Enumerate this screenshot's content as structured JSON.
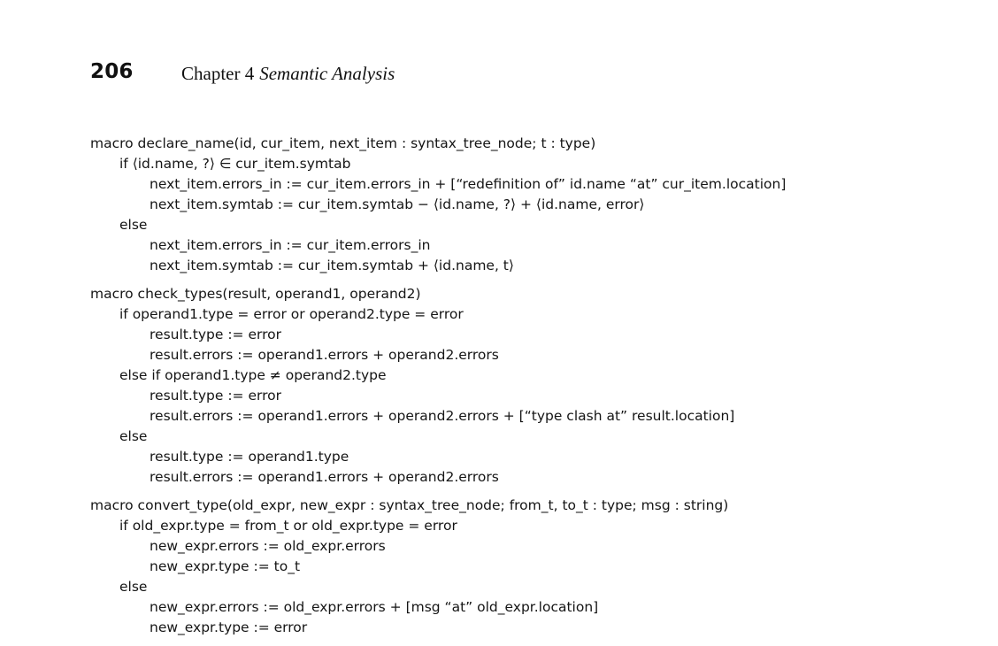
{
  "header": {
    "page_number": "206",
    "chapter_label": "Chapter 4",
    "chapter_title": "Semantic Analysis"
  },
  "code_blocks": [
    {
      "lines": [
        {
          "indent": 0,
          "text": "macro declare_name(id, cur_item, next_item : syntax_tree_node; t : type)"
        },
        {
          "indent": 1,
          "text": "if ⟨id.name, ?⟩ ∈ cur_item.symtab"
        },
        {
          "indent": 2,
          "text": "next_item.errors_in := cur_item.errors_in + [“redefinition of” id.name “at” cur_item.location]"
        },
        {
          "indent": 2,
          "text": "next_item.symtab := cur_item.symtab − ⟨id.name, ?⟩ + ⟨id.name, error⟩"
        },
        {
          "indent": 1,
          "text": "else"
        },
        {
          "indent": 2,
          "text": "next_item.errors_in := cur_item.errors_in"
        },
        {
          "indent": 2,
          "text": "next_item.symtab := cur_item.symtab + ⟨id.name, t⟩"
        }
      ]
    },
    {
      "lines": [
        {
          "indent": 0,
          "text": "macro check_types(result, operand1, operand2)"
        },
        {
          "indent": 1,
          "text": "if operand1.type = error or operand2.type = error"
        },
        {
          "indent": 2,
          "text": "result.type := error"
        },
        {
          "indent": 2,
          "text": "result.errors := operand1.errors + operand2.errors"
        },
        {
          "indent": 1,
          "text": "else if operand1.type ≠ operand2.type"
        },
        {
          "indent": 2,
          "text": "result.type := error"
        },
        {
          "indent": 2,
          "text": "result.errors := operand1.errors + operand2.errors + [“type clash at” result.location]"
        },
        {
          "indent": 1,
          "text": "else"
        },
        {
          "indent": 2,
          "text": "result.type := operand1.type"
        },
        {
          "indent": 2,
          "text": "result.errors := operand1.errors + operand2.errors"
        }
      ]
    },
    {
      "lines": [
        {
          "indent": 0,
          "text": "macro convert_type(old_expr, new_expr : syntax_tree_node; from_t, to_t : type; msg : string)"
        },
        {
          "indent": 1,
          "text": "if old_expr.type = from_t or old_expr.type = error"
        },
        {
          "indent": 2,
          "text": "new_expr.errors := old_expr.errors"
        },
        {
          "indent": 2,
          "text": "new_expr.type := to_t"
        },
        {
          "indent": 1,
          "text": "else"
        },
        {
          "indent": 2,
          "text": "new_expr.errors := old_expr.errors + [msg “at” old_expr.location]"
        },
        {
          "indent": 2,
          "text": "new_expr.type := error"
        }
      ]
    }
  ]
}
